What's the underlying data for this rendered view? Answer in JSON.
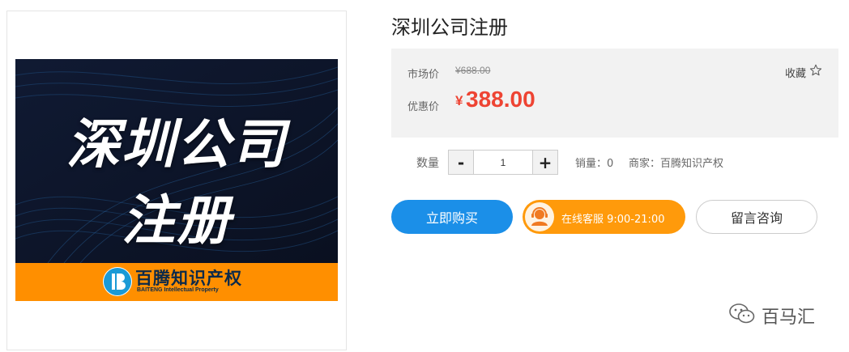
{
  "product": {
    "title": "深圳公司注册",
    "image": {
      "title_line1": "深圳公司",
      "title_line2": "注册",
      "brand_cn": "百腾知识产权",
      "brand_en": "BAITENG Intellectual Property",
      "logo_icon": "baiteng-logo-icon"
    }
  },
  "price": {
    "market_label": "市场价",
    "market_value": "¥688.00",
    "discount_label": "优惠价",
    "currency_symbol": "¥",
    "discount_value": "388.00",
    "favorite_label": "收藏",
    "favorite_icon": "star-outline-icon"
  },
  "quantity": {
    "label": "数量",
    "minus": "-",
    "value": "1",
    "plus": "+",
    "sales": "销量：0",
    "merchant": "商家：百腾知识产权"
  },
  "actions": {
    "buy_label": "立即购买",
    "service_label": "在线客服 9:00-21:00",
    "service_icon": "customer-service-avatar-icon",
    "consult_label": "留言咨询"
  },
  "watermark": {
    "text": "百马汇",
    "icon": "wechat-icon"
  },
  "colors": {
    "accent_blue": "#1b8fe8",
    "price_red": "#ee4433",
    "service_orange": "#ff9a0b",
    "banner_orange": "#ff8f00",
    "banner_navy": "#0a1226"
  }
}
